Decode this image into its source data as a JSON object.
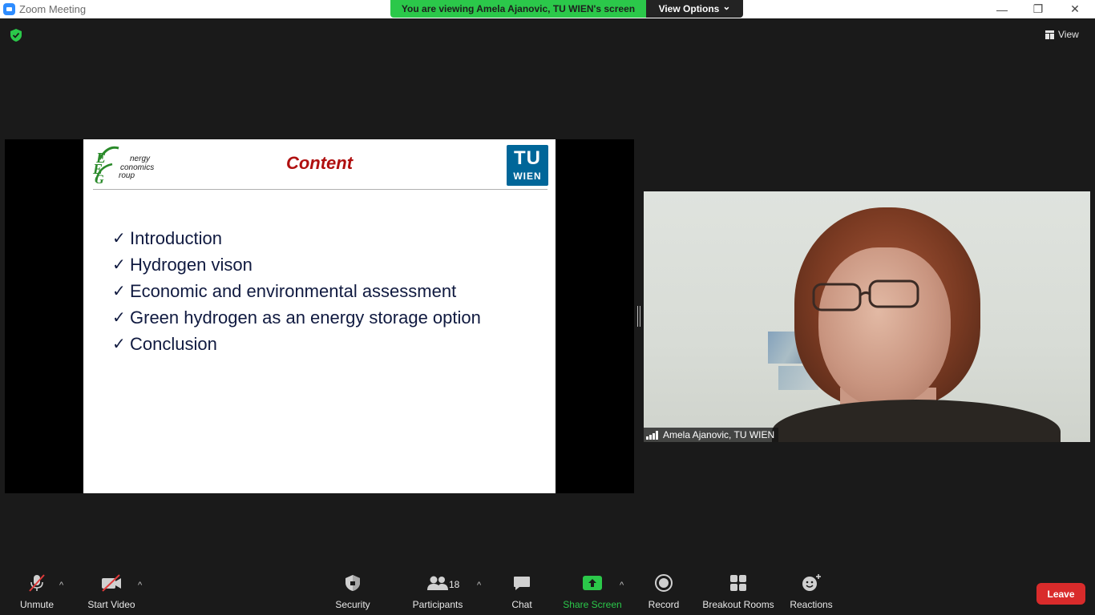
{
  "window": {
    "title": "Zoom Meeting",
    "minimize": "—",
    "restore": "❐",
    "close": "✕"
  },
  "banner": {
    "viewing": "You are viewing Amela Ajanovic, TU WIEN's screen",
    "view_options": "View Options",
    "chevron": "⌄"
  },
  "top": {
    "view_label": "View"
  },
  "slide": {
    "title": "Content",
    "eeg_logo_lines": [
      "nergy",
      "conomics",
      "roup"
    ],
    "eeg_logo_letters": [
      "E",
      "E",
      "G"
    ],
    "tu_top": "TU",
    "tu_bottom": "WIEN",
    "check": "✓",
    "bullets": [
      "Introduction",
      "Hydrogen vison",
      "Economic and environmental assessment",
      "Green hydrogen as an energy storage option",
      "Conclusion"
    ]
  },
  "video": {
    "participant_name": "Amela Ajanovic, TU WIEN"
  },
  "toolbar": {
    "unmute": "Unmute",
    "start_video": "Start Video",
    "security": "Security",
    "participants": "Participants",
    "participants_count": "18",
    "chat": "Chat",
    "share_screen": "Share Screen",
    "record": "Record",
    "breakout_rooms": "Breakout Rooms",
    "reactions": "Reactions",
    "leave": "Leave",
    "caret": "^"
  },
  "colors": {
    "accent_green": "#2bc84a",
    "leave_red": "#d92b2b",
    "slide_title_red": "#b01010",
    "tu_blue": "#006699"
  }
}
